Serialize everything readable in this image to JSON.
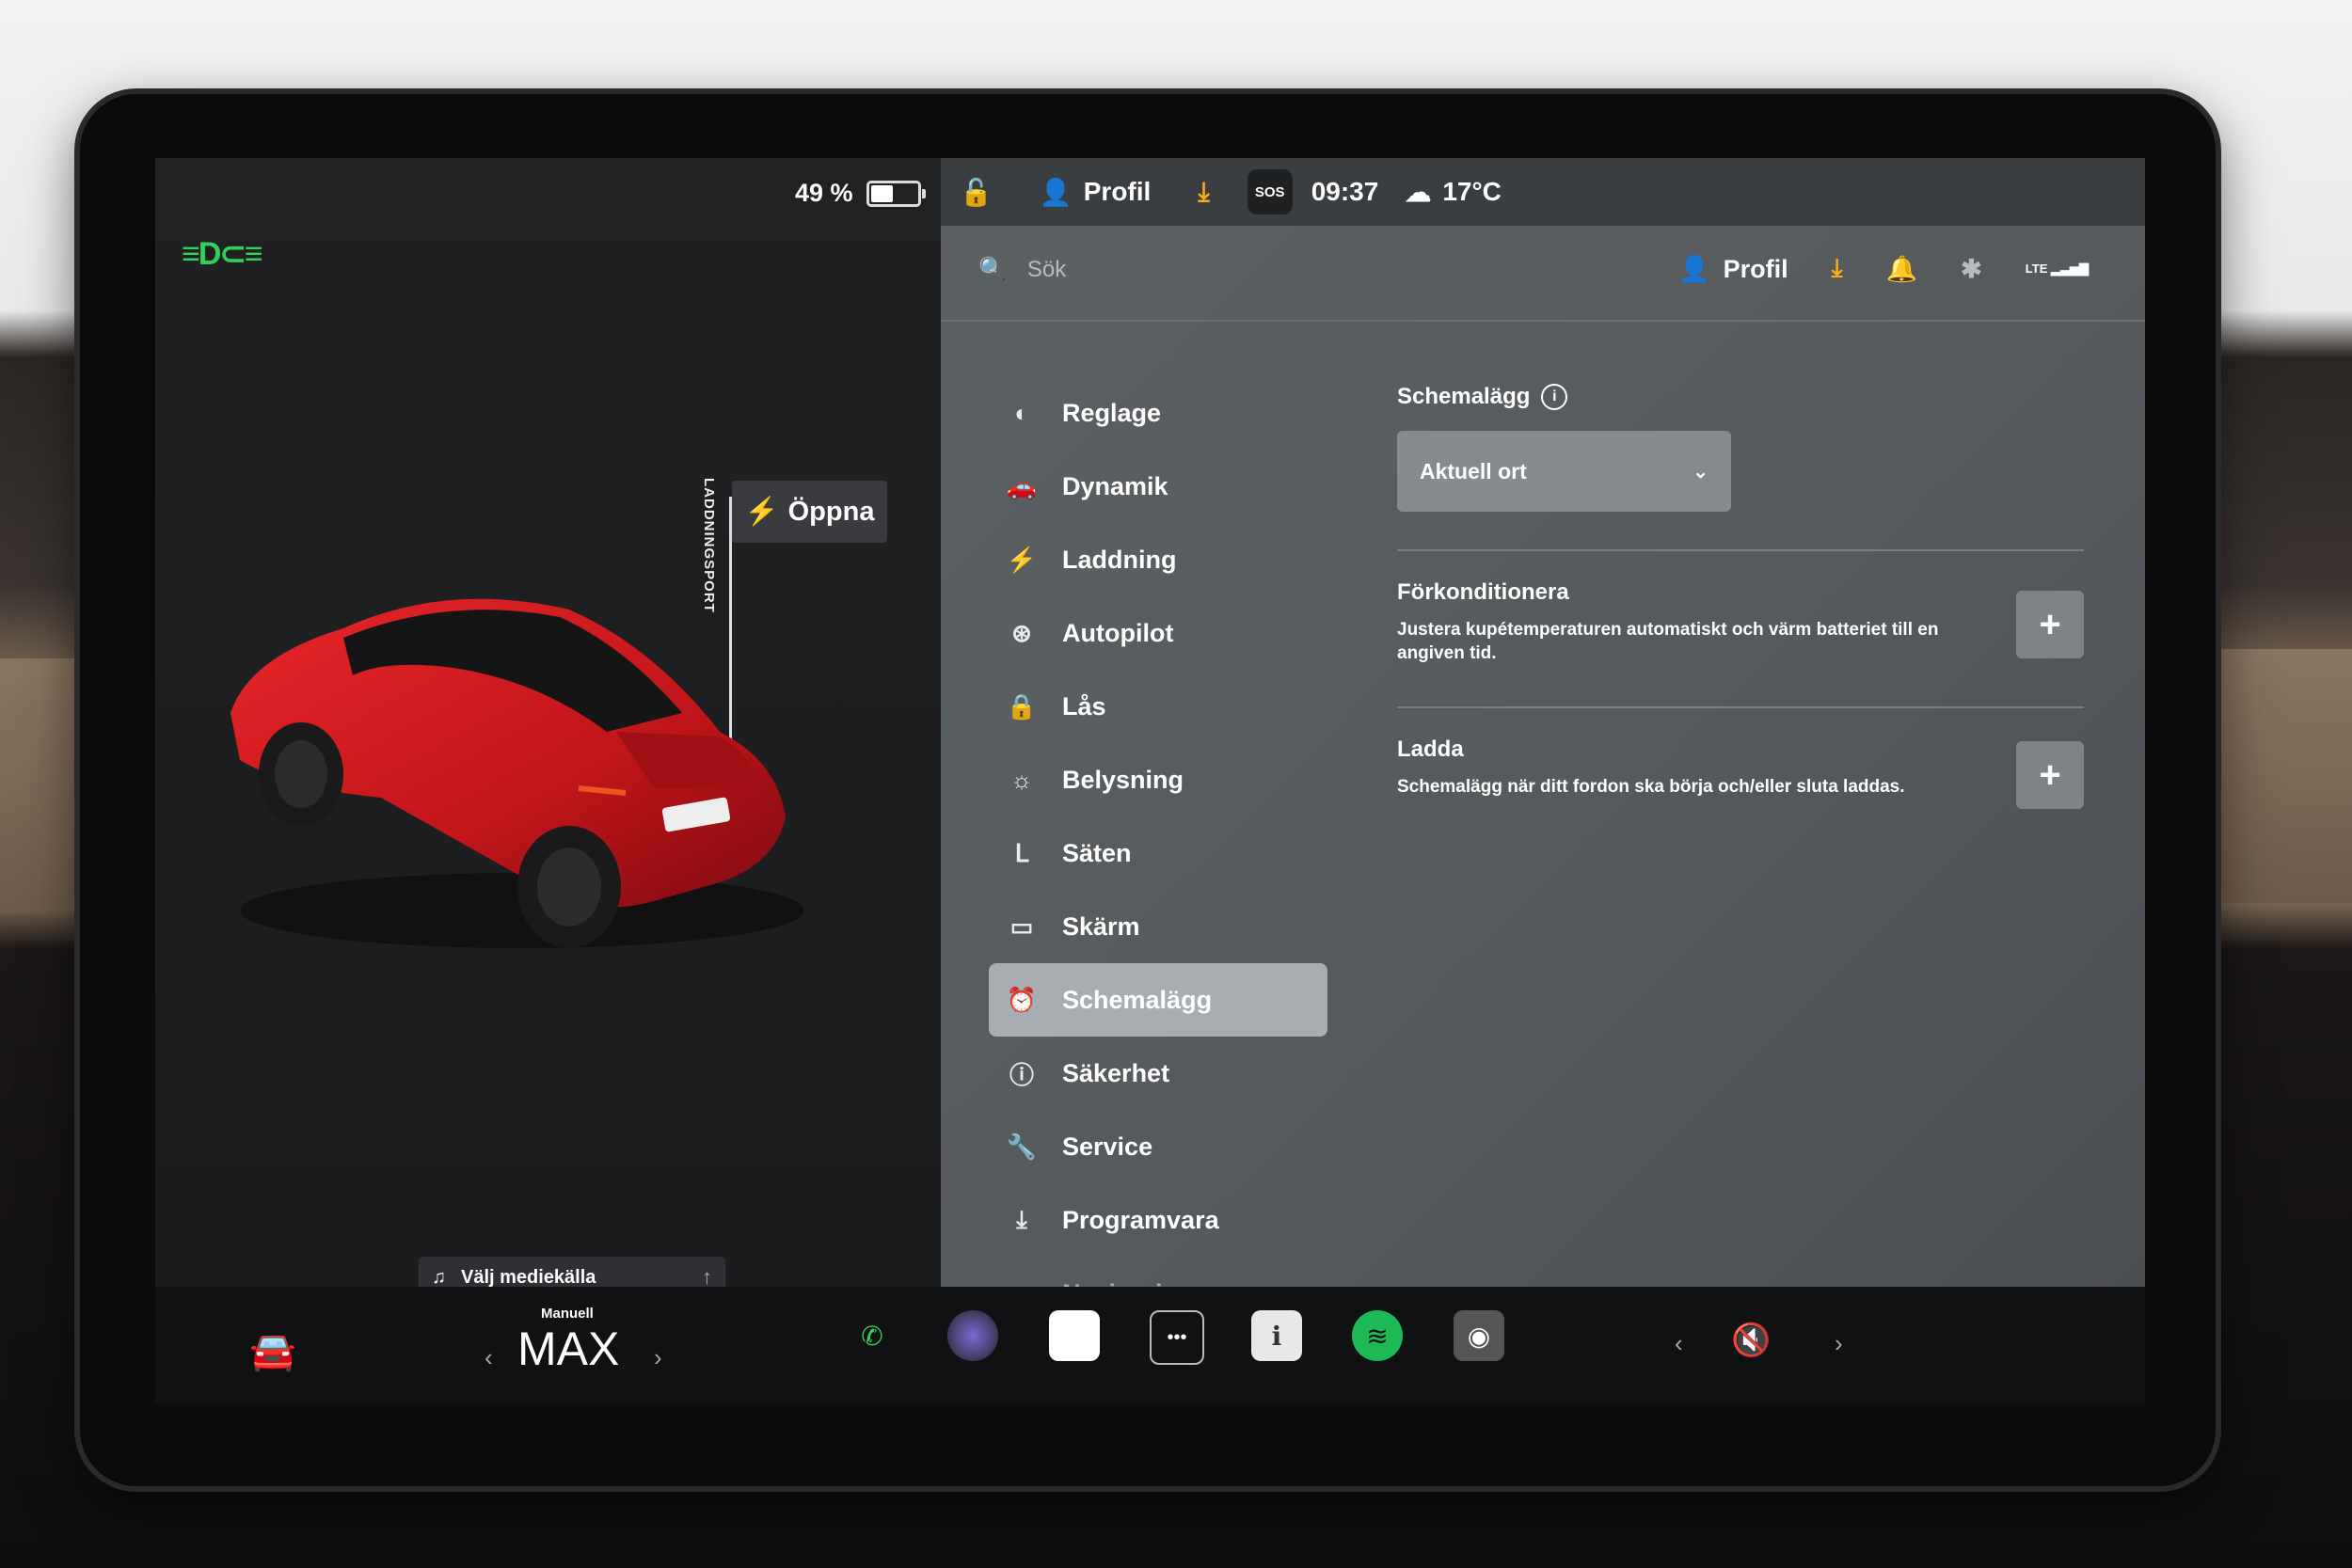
{
  "status": {
    "battery_percent": "49 %",
    "battery_level": 0.49,
    "time": "09:37",
    "temperature": "17°C",
    "sos": "SOS",
    "profile": "Profil"
  },
  "car": {
    "port_label": "LADDNINGSPORT",
    "open_label": "Öppna"
  },
  "search": {
    "placeholder": "Sök",
    "profile": "Profil",
    "network": "LTE"
  },
  "menu": {
    "items": [
      {
        "label": "Reglage",
        "icon": "toggle-icon"
      },
      {
        "label": "Dynamik",
        "icon": "car-icon"
      },
      {
        "label": "Laddning",
        "icon": "bolt-icon"
      },
      {
        "label": "Autopilot",
        "icon": "steering-wheel-icon"
      },
      {
        "label": "Lås",
        "icon": "lock-icon"
      },
      {
        "label": "Belysning",
        "icon": "light-icon"
      },
      {
        "label": "Säten",
        "icon": "seat-icon"
      },
      {
        "label": "Skärm",
        "icon": "screen-icon"
      },
      {
        "label": "Schemalägg",
        "icon": "alarm-clock-icon",
        "active": true
      },
      {
        "label": "Säkerhet",
        "icon": "alert-icon"
      },
      {
        "label": "Service",
        "icon": "wrench-icon"
      },
      {
        "label": "Programvara",
        "icon": "download-icon"
      },
      {
        "label": "Navigering",
        "icon": "navigation-icon"
      }
    ]
  },
  "schedule": {
    "title": "Schemalägg",
    "location": "Aktuell ort",
    "precondition_title": "Förkonditionera",
    "precondition_desc": "Justera kupétemperaturen automatiskt och värm batteriet till en angiven tid.",
    "charge_title": "Ladda",
    "charge_desc": "Schemalägg när ditt fordon ska börja och/eller sluta laddas."
  },
  "bottom": {
    "media_label": "Välj mediekälla",
    "fan_mode": "Manuell",
    "fan_value": "MAX"
  }
}
